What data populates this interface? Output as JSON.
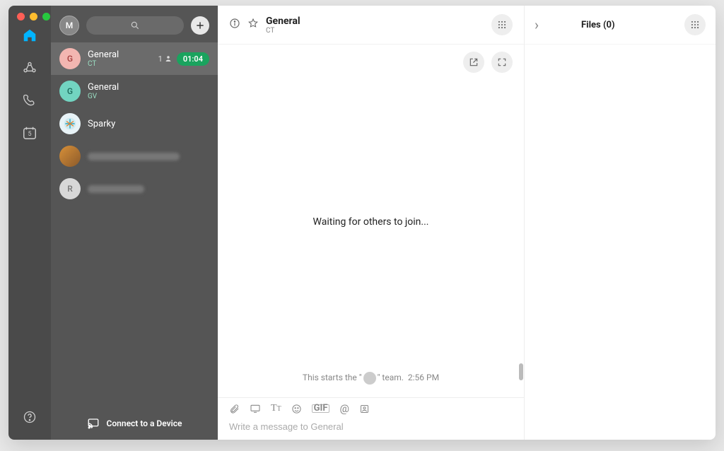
{
  "me": {
    "initial": "M"
  },
  "search": {
    "placeholder": "Search"
  },
  "nav": {
    "calendar_day": "5"
  },
  "conversations": [
    {
      "name": "General",
      "sub": "CT",
      "avatar_letter": "G",
      "avatar_bg": "#f3b6b1",
      "avatar_fg": "#a63f3f",
      "people_count": "1",
      "timer": "01:04",
      "selected": true
    },
    {
      "name": "General",
      "sub": "GV",
      "avatar_letter": "G",
      "avatar_bg": "#72d4c1",
      "avatar_fg": "#1b6b5c"
    },
    {
      "name": "Sparky",
      "sub": "",
      "avatar_letter": "",
      "avatar_bg": "#bfe1ea",
      "avatar_fg": "#2c7a93",
      "avatar_img": true
    },
    {
      "blurred": true,
      "avatar_img": true,
      "avatar_bg": "#d8a24a"
    },
    {
      "blurred": true,
      "avatar_letter": "R",
      "avatar_bg": "#d8d8d8",
      "avatar_fg": "#777",
      "small_blur": true
    }
  ],
  "connect_label": "Connect to a Device",
  "chat": {
    "title": "General",
    "subtitle": "CT",
    "waiting_text": "Waiting for others to join...",
    "history_prefix": "This starts the \"",
    "history_suffix": "\" team.",
    "history_time": "2:56 PM",
    "compose_placeholder": "Write a message to General"
  },
  "files": {
    "title": "Files (0)"
  },
  "tool_gif": "GIF"
}
